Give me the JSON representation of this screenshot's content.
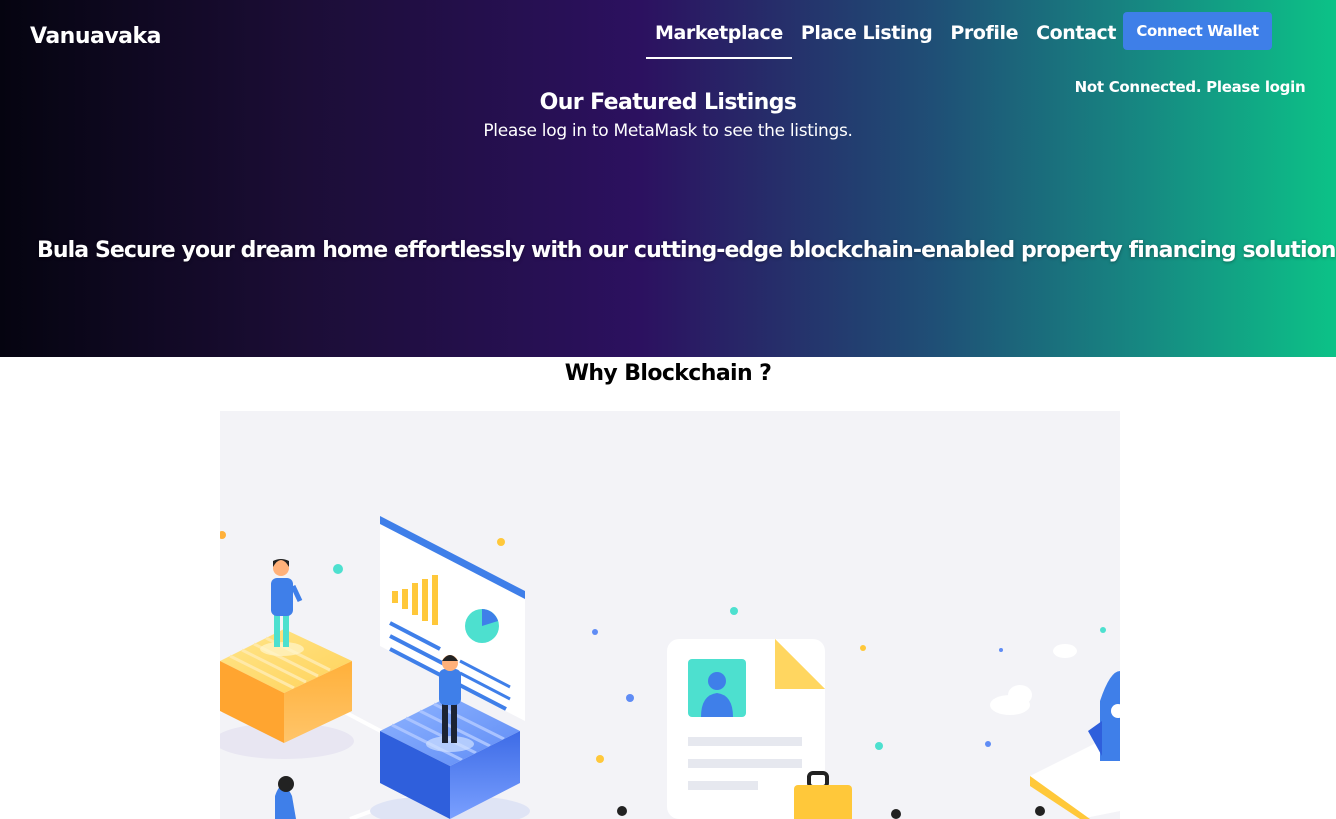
{
  "brand": {
    "name": "Vanuavaka"
  },
  "nav": {
    "items": [
      {
        "label": "Marketplace",
        "active": true
      },
      {
        "label": "Place Listing",
        "active": false
      },
      {
        "label": "Profile",
        "active": false
      },
      {
        "label": "Contact Us",
        "active": false
      }
    ],
    "connect_label": "Connect Wallet",
    "status_text": "Not Connected. Please login"
  },
  "featured": {
    "title": "Our Featured Listings",
    "subtitle": "Please log in to MetaMask to see the listings."
  },
  "hero": {
    "tagline": "Bula Secure your dream home effortlessly with our cutting-edge blockchain-enabled property financing solution."
  },
  "why": {
    "title": "Why Blockchain ?"
  },
  "colors": {
    "hero_gradient": [
      "#050410",
      "#2c1160",
      "#0cc287"
    ],
    "button": "#3e7fe8",
    "illustration_bg": "#f3f3f7"
  },
  "illustration": {
    "icon": "blockchain-isometric-illustration"
  }
}
